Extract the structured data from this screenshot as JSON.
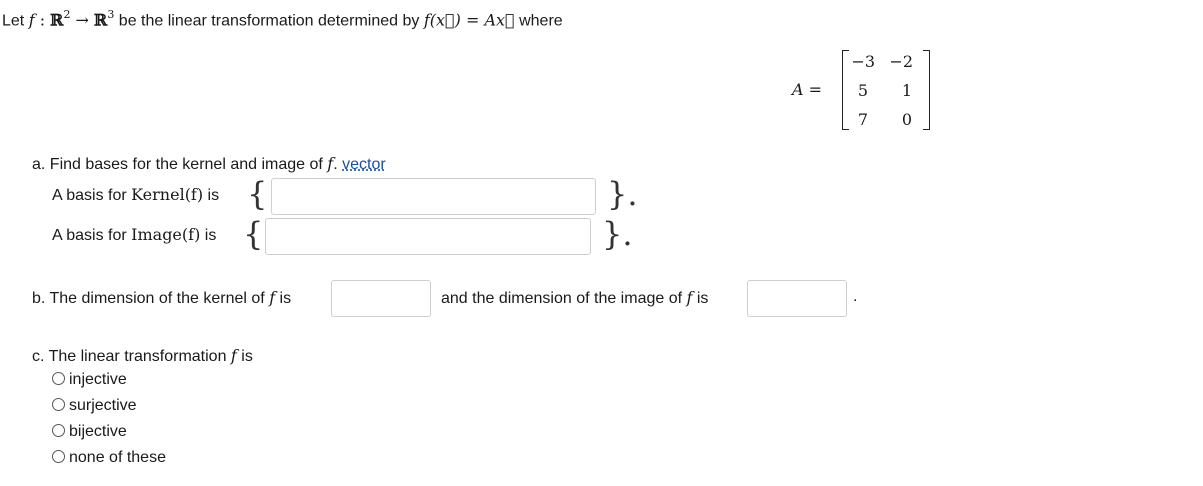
{
  "intro": {
    "prefix": "Let ",
    "f": "f",
    "colon": " : ",
    "domain_R": "ℝ",
    "domain_exp": "2",
    "arrow": " → ",
    "codomain_R": "ℝ",
    "codomain_exp": "3",
    "middle": " be the linear transformation determined by ",
    "formula": "f(x⃗) = Ax⃗",
    "suffix": " where"
  },
  "matrix": {
    "label": "A =",
    "rows": [
      [
        "−3",
        "−2"
      ],
      [
        "5",
        "1"
      ],
      [
        "7",
        "0"
      ]
    ]
  },
  "part_a": {
    "question_prefix": "a. Find bases for the kernel and image of ",
    "f": "f",
    "question_suffix": ".",
    "link": "vector",
    "kernel_label_prefix": "A basis for ",
    "kernel_math": "Kernel(f)",
    "kernel_label_suffix": " is",
    "kernel_value": "",
    "image_label_prefix": "A basis for ",
    "image_math": "Image(f)",
    "image_label_suffix": " is",
    "image_value": "",
    "open_brace": "{",
    "close_brace": "}."
  },
  "part_b": {
    "text1_prefix": "b. The dimension of the kernel of ",
    "f": "f",
    "text1_suffix": " is",
    "kernel_dim_value": "",
    "text2_prefix": "and the dimension of the image of ",
    "text2_suffix": " is",
    "image_dim_value": "",
    "end": "."
  },
  "part_c": {
    "question_prefix": "c. The linear transformation ",
    "f": "f",
    "question_suffix": " is",
    "options": [
      "injective",
      "surjective",
      "bijective",
      "none of these"
    ]
  }
}
